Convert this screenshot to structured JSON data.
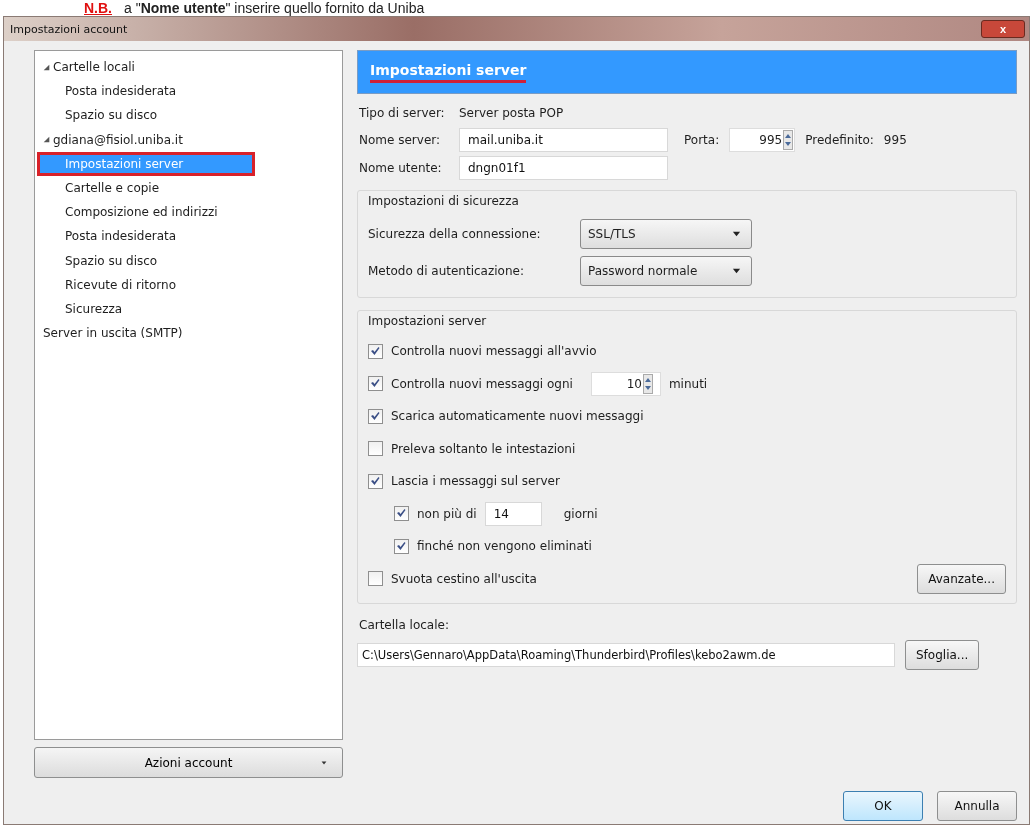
{
  "note": {
    "label": "N.B.",
    "text": "a \"**Nome utente**\" inserire quello fornito da Uniba"
  },
  "window": {
    "title": "Impostazioni account",
    "close": "x"
  },
  "tree": [
    {
      "label": "Cartelle locali",
      "expanded": true,
      "selected": false,
      "annotated": false,
      "children": [
        {
          "label": "Posta indesiderata",
          "selected": false,
          "annotated": false
        },
        {
          "label": "Spazio su disco",
          "selected": false,
          "annotated": false
        }
      ]
    },
    {
      "label": "gdiana@fisiol.uniba.it",
      "expanded": true,
      "selected": false,
      "annotated": false,
      "children": [
        {
          "label": "Impostazioni server",
          "selected": true,
          "annotated": true
        },
        {
          "label": "Cartelle e copie",
          "selected": false,
          "annotated": false
        },
        {
          "label": "Composizione ed indirizzi",
          "selected": false,
          "annotated": false
        },
        {
          "label": "Posta indesiderata",
          "selected": false,
          "annotated": false
        },
        {
          "label": "Spazio su disco",
          "selected": false,
          "annotated": false
        },
        {
          "label": "Ricevute di ritorno",
          "selected": false,
          "annotated": false
        },
        {
          "label": "Sicurezza",
          "selected": false,
          "annotated": false
        }
      ]
    },
    {
      "label": "Server in uscita (SMTP)",
      "selected": false,
      "annotated": false
    }
  ],
  "account_actions": "Azioni account",
  "header": {
    "title": "Impostazioni server",
    "annotated": true
  },
  "server_type": {
    "label": "Tipo di server:",
    "value": "Server posta POP"
  },
  "server_name": {
    "label": "Nome server:",
    "value": "mail.uniba.it"
  },
  "port": {
    "label": "Porta:",
    "value": "995",
    "default_label": "Predefinito:",
    "default_value": "995"
  },
  "user_name": {
    "label": "Nome utente:",
    "value": "dngn01f1"
  },
  "security": {
    "legend": "Impostazioni di sicurezza",
    "rows": [
      {
        "label": "Sicurezza della connessione:",
        "value": "SSL/TLS"
      },
      {
        "label": "Metodo di autenticazione:",
        "value": "Password normale"
      }
    ]
  },
  "server_settings": {
    "legend": "Impostazioni server",
    "options": [
      {
        "kind": "check",
        "label": "Controlla nuovi messaggi all'avvio",
        "checked": true
      },
      {
        "kind": "spin",
        "label": "Controlla nuovi messaggi ogni",
        "checked": true,
        "value": "10",
        "unit": "minuti"
      },
      {
        "kind": "check",
        "label": "Scarica automaticamente nuovi messaggi",
        "checked": true
      },
      {
        "kind": "check",
        "label": "Preleva soltanto le intestazioni",
        "checked": false
      },
      {
        "kind": "check",
        "label": "Lascia i messaggi sul server",
        "checked": true,
        "children": [
          {
            "kind": "field",
            "label": "non più di",
            "checked": true,
            "value": "14",
            "unit": "giorni"
          },
          {
            "kind": "check",
            "label": "finché non vengono eliminati",
            "checked": true
          }
        ]
      },
      {
        "kind": "check",
        "label": "Svuota cestino all'uscita",
        "checked": false
      }
    ],
    "advanced": "Avanzate..."
  },
  "local_folder": {
    "label": "Cartella locale:",
    "value": "C:\\Users\\Gennaro\\AppData\\Roaming\\Thunderbird\\Profiles\\kebo2awm.de",
    "browse": "Sfoglia..."
  },
  "buttons": [
    "OK",
    "Annulla"
  ]
}
